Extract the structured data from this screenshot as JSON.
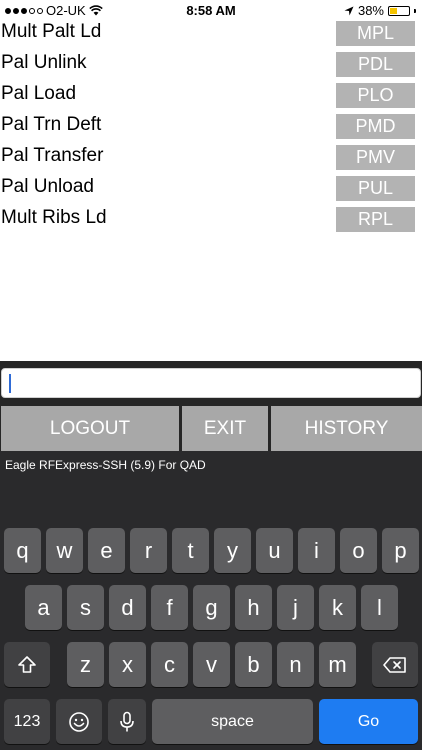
{
  "status_bar": {
    "carrier": "O2-UK",
    "time": "8:58 AM",
    "battery": "38%",
    "battery_level": 0.38,
    "icons": [
      "signal-dots-icon",
      "wifi-icon",
      "location-arrow-icon",
      "battery-icon"
    ]
  },
  "menu": {
    "items": [
      {
        "label": "Mult Palt Ld",
        "code": "MPL"
      },
      {
        "label": "Pal Unlink",
        "code": "PDL"
      },
      {
        "label": "Pal Load",
        "code": "PLO"
      },
      {
        "label": "Pal Trn Deft",
        "code": "PMD"
      },
      {
        "label": "Pal Transfer",
        "code": "PMV"
      },
      {
        "label": "Pal Unload",
        "code": "PUL"
      },
      {
        "label": "Mult Ribs Ld",
        "code": "RPL"
      }
    ]
  },
  "command": {
    "input_value": ""
  },
  "buttons": {
    "logout": "LOGOUT",
    "exit": "EXIT",
    "history": "HISTORY"
  },
  "app_caption": "Eagle RFExpress-SSH (5.9) For QAD",
  "keyboard": {
    "row1": [
      "q",
      "w",
      "e",
      "r",
      "t",
      "y",
      "u",
      "i",
      "o",
      "p"
    ],
    "row2": [
      "a",
      "s",
      "d",
      "f",
      "g",
      "h",
      "j",
      "k",
      "l"
    ],
    "row3": [
      "z",
      "x",
      "c",
      "v",
      "b",
      "n",
      "m"
    ],
    "numbers_key": "123",
    "space_key": "space",
    "go_key": "Go",
    "icons": [
      "shift-icon",
      "backspace-icon",
      "emoji-icon",
      "microphone-icon"
    ]
  },
  "colors": {
    "code_badge": "#b3b3b3",
    "function_button": "#a8a8a8",
    "go_key": "#1e7cf2",
    "keyboard_bg": "#2a2a2c"
  }
}
